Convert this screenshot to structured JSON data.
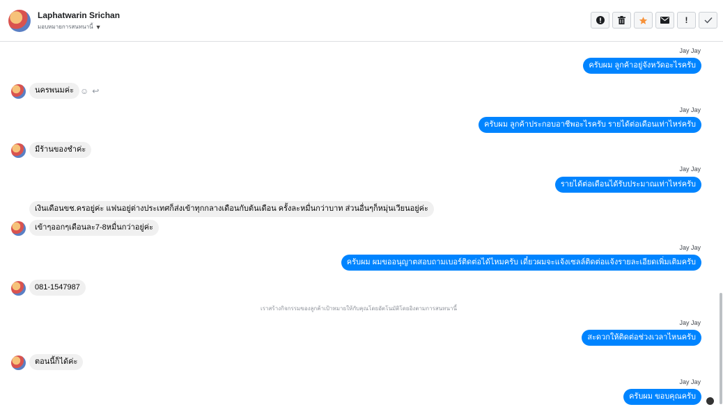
{
  "header": {
    "contact_name": "Laphatwarin Srichan",
    "assign_label": "มอบหมายการสนทนานี้",
    "toolbar": {
      "icons": [
        "alert-circle-icon",
        "trash-icon",
        "star-icon",
        "envelope-icon",
        "exclamation-icon",
        "check-icon"
      ],
      "colors": {
        "star": "#f7923a"
      }
    }
  },
  "chat": {
    "outgoing_sender": "Jay Jay",
    "messages": [
      {
        "dir": "out",
        "sender": "Jay Jay",
        "text": "ครับผม ลูกค้าอยู่จังหวัดอะไรครับ"
      },
      {
        "dir": "in",
        "text": "นครพนมค่ะ"
      },
      {
        "dir": "out",
        "sender": "Jay Jay",
        "text": "ครับผม ลูกค้าประกอบอาชีพอะไรครับ รายได้ต่อเดือนเท่าไหร่ครับ"
      },
      {
        "dir": "in",
        "text": "มีร้านของชำค่ะ"
      },
      {
        "dir": "out",
        "sender": "Jay Jay",
        "text": "รายได้ต่อเดือนได้รับประมาณเท่าไหร่ครับ"
      },
      {
        "dir": "in",
        "text": "เงินเดือนขช.ครอยู่ค่ะ แฟนอยู่ต่างประเทศก็ส่งเข้าทุกกลางเดือนกับต้นเดือน ครั้งละหมื่นกว่าบาท ส่วนอื่นๆก็หมุ่นเวียนอยู่ค่ะ"
      },
      {
        "dir": "in",
        "text": "เข้าๆออกๆเดือนละ7-8หมื่นกว่าอยู่ค่ะ"
      },
      {
        "dir": "out",
        "sender": "Jay Jay",
        "text": "ครับผม ผมขออนุญาตสอบถามเบอร์ติดต่อได้ไหมครับ เดี๋ยวผมจะแจ้งเซลล์ติดต่อแจ้งรายละเอียดเพิ่มเติมครับ"
      },
      {
        "dir": "in",
        "text": "081-1547987"
      },
      {
        "dir": "system",
        "text": "เราสร้างกิจกรรมของลูกค้าเป้าหมายให้กับคุณโดยอัตโนมัติโดยอิงตามการสนทนานี้"
      },
      {
        "dir": "out",
        "sender": "Jay Jay",
        "text": "สะดวกให้ติดต่อช่วงเวลาไหนครับ"
      },
      {
        "dir": "in",
        "text": "ตอนนี้ก็ได้ค่ะ"
      },
      {
        "dir": "out",
        "sender": "Jay Jay",
        "text": "ครับผม ขอบคุณครับ"
      }
    ],
    "colors": {
      "outgoing_bubble": "#0084ff",
      "incoming_bubble": "#f0f0f0"
    }
  }
}
